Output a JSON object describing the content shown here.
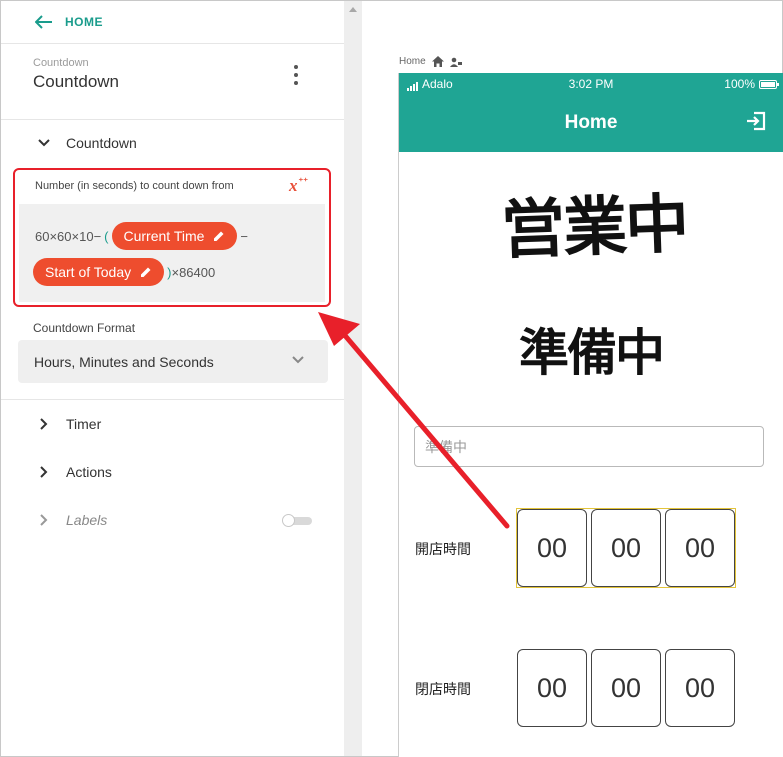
{
  "sidebar": {
    "back_label": "HOME",
    "component_type": "Countdown",
    "component_name": "Countdown",
    "sections": {
      "countdown": "Countdown",
      "timer": "Timer",
      "actions": "Actions",
      "labels": "Labels"
    },
    "formula": {
      "label": "Number (in seconds) to count down from",
      "fx_icon": "x",
      "line1_prefix": "60×60×10−",
      "paren_open": "(",
      "pill1": "Current Time",
      "minus": "−",
      "pill2": "Start of Today",
      "paren_close": ")",
      "line2_suffix": "×86400"
    },
    "format": {
      "label": "Countdown Format",
      "value": "Hours, Minutes and Seconds"
    },
    "labels_toggle_on": false
  },
  "canvas": {
    "screen_name": "Home",
    "status": {
      "carrier": "Adalo",
      "time": "3:02 PM",
      "battery": "100%"
    },
    "app_title": "Home",
    "image_big_text": "営業中",
    "image_mid_text": "準備中",
    "input_placeholder": "準備中",
    "open_label": "開店時間",
    "close_label": "閉店時間",
    "open_digits": [
      "00",
      "00",
      "00"
    ],
    "close_digits": [
      "00",
      "00",
      "00"
    ]
  },
  "colors": {
    "teal": "#1fa594",
    "pill": "#ee4d2e",
    "highlight": "#e8202a"
  }
}
